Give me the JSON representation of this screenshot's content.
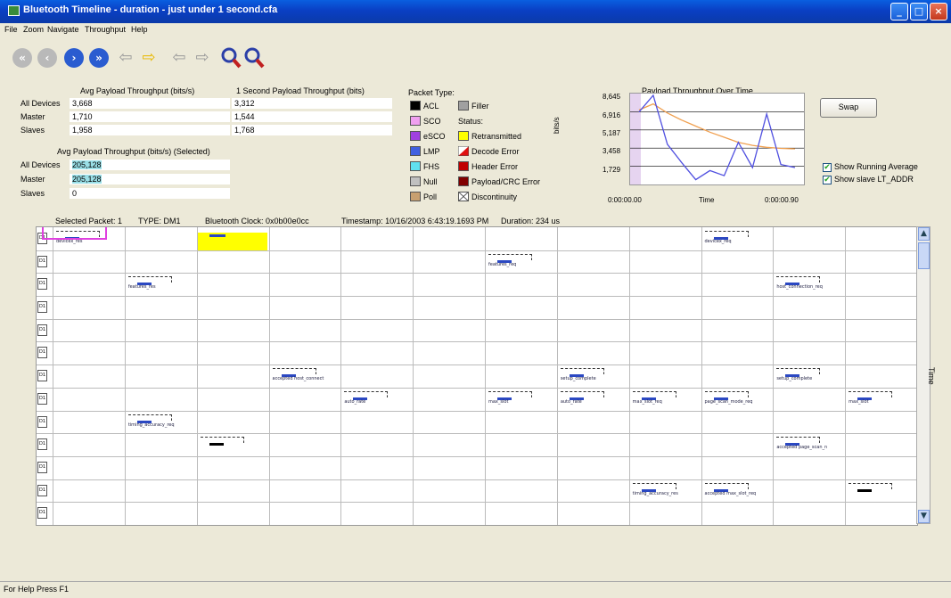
{
  "window": {
    "title": "Bluetooth Timeline - duration - just under 1 second.cfa"
  },
  "menu": [
    "File",
    "Zoom",
    "Navigate",
    "Throughput",
    "Help"
  ],
  "toolbar": {
    "buttons": [
      {
        "name": "first-icon",
        "glyph": "⏮"
      },
      {
        "name": "previous-icon",
        "glyph": "◀"
      },
      {
        "name": "next-icon",
        "glyph": "▶"
      },
      {
        "name": "last-icon",
        "glyph": "⏭"
      },
      {
        "name": "back-arrow-icon",
        "glyph": "⇦"
      },
      {
        "name": "forward-arrow-icon",
        "glyph": "⇨"
      },
      {
        "name": "back-arrow-icon",
        "glyph": "⇦"
      },
      {
        "name": "forward-arrow-icon",
        "glyph": "⇨"
      },
      {
        "name": "zoom-in-icon",
        "glyph": "🔍"
      },
      {
        "name": "zoom-out-icon",
        "glyph": "🔍"
      }
    ]
  },
  "stats": {
    "avg_header": "Avg Payload Throughput (bits/s)",
    "one_sec_header": "1 Second Payload Throughput (bits)",
    "rows": [
      {
        "label": "All Devices",
        "avg": "3,668",
        "one_sec": "3,312"
      },
      {
        "label": "Master",
        "avg": "1,710",
        "one_sec": "1,544"
      },
      {
        "label": "Slaves",
        "avg": "1,958",
        "one_sec": "1,768"
      }
    ],
    "selected_header": "Avg Payload Throughput (bits/s) (Selected)",
    "selected_rows": [
      {
        "label": "All Devices",
        "value": "205,128"
      },
      {
        "label": "Master",
        "value": "205,128"
      },
      {
        "label": "Slaves",
        "value": "0"
      }
    ]
  },
  "packet_type": {
    "title": "Packet Type:",
    "types": [
      {
        "label": "ACL",
        "color": "#000000"
      },
      {
        "label": "SCO",
        "color": "#f0a0f0"
      },
      {
        "label": "eSCO",
        "color": "#a040e0"
      },
      {
        "label": "LMP",
        "color": "#4060e0"
      },
      {
        "label": "FHS",
        "color": "#60e0f0"
      },
      {
        "label": "Null",
        "color": "#c0c0c0"
      },
      {
        "label": "Poll",
        "color": "#c8a070"
      }
    ],
    "filler": "Filler",
    "status_title": "Status:",
    "statuses": [
      {
        "label": "Retransmitted",
        "color": "#ffff00"
      },
      {
        "label": "Decode Error",
        "color": "#e01010"
      },
      {
        "label": "Header Error",
        "color": "#c00000"
      },
      {
        "label": "Payload/CRC Error",
        "color": "#800000"
      },
      {
        "label": "Discontinuity",
        "color": "#ffffff"
      }
    ]
  },
  "mini_chart": {
    "title": "Payload Throughput Over Time",
    "ylabel": "bits/s",
    "xlabel": "Time",
    "y_ticks": [
      "8,645",
      "6,916",
      "5,187",
      "3,458",
      "1,729"
    ],
    "x_start": "0:00:00.00",
    "x_end": "0:00:00.90",
    "series": [
      {
        "name": "running-average",
        "color": "#f0a050",
        "values": [
          7200,
          7800,
          6900,
          6200,
          5600,
          5000,
          4500,
          4000,
          3700,
          3500,
          3400,
          3350
        ]
      },
      {
        "name": "slave-lt-addr",
        "color": "#5050e0",
        "values": [
          7000,
          8645,
          3800,
          2000,
          300,
          1200,
          700,
          4000,
          1500,
          6800,
          1800,
          1500
        ]
      }
    ]
  },
  "swap_label": "Swap",
  "checkboxes": [
    {
      "label": "Show Running Average",
      "checked": "✔"
    },
    {
      "label": "Show slave LT_ADDR",
      "checked": "✔"
    }
  ],
  "selected_packet": {
    "label": "Selected Packet: 1",
    "type": "TYPE: DM1",
    "clock": "Bluetooth Clock: 0x0b00e0cc",
    "timestamp": "Timestamp: 10/16/2003 6:43:19.1693 PM",
    "duration": "Duration: 234 us"
  },
  "timeline": {
    "rows": 13,
    "cols": 12,
    "device_label": "D1",
    "packets": [
      {
        "row": 0,
        "col": 0,
        "label": "devicex_res"
      },
      {
        "row": 0,
        "col": 9,
        "label": "devicex_req"
      },
      {
        "row": 1,
        "col": 6,
        "label": "features_req"
      },
      {
        "row": 2,
        "col": 1,
        "label": "features_res"
      },
      {
        "row": 2,
        "col": 10,
        "label": "host_connection_req"
      },
      {
        "row": 6,
        "col": 3,
        "label": "accepted host_connect"
      },
      {
        "row": 6,
        "col": 7,
        "label": "setup_complete"
      },
      {
        "row": 6,
        "col": 10,
        "label": "setup_complete"
      },
      {
        "row": 7,
        "col": 4,
        "label": "auto_rate"
      },
      {
        "row": 7,
        "col": 6,
        "label": "max_slot"
      },
      {
        "row": 7,
        "col": 7,
        "label": "auto_rate"
      },
      {
        "row": 7,
        "col": 8,
        "label": "max_slot_req"
      },
      {
        "row": 7,
        "col": 9,
        "label": "page_scan_mode_req"
      },
      {
        "row": 7,
        "col": 11,
        "label": "max_slot"
      },
      {
        "row": 8,
        "col": 1,
        "label": "timing_accuracy_req"
      },
      {
        "row": 9,
        "col": 2,
        "label": ""
      },
      {
        "row": 9,
        "col": 10,
        "label": "accepted page_scan_n"
      },
      {
        "row": 11,
        "col": 8,
        "label": "timing_accuracy_res"
      },
      {
        "row": 11,
        "col": 9,
        "label": "accepted max_slot_req"
      },
      {
        "row": 11,
        "col": 11,
        "label": ""
      }
    ],
    "time_label": "Time"
  },
  "status_bar": "For Help Press F1"
}
